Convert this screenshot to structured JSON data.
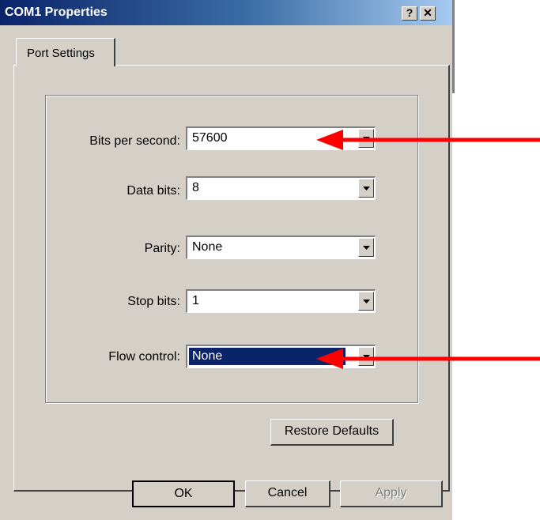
{
  "window": {
    "title": "COM1 Properties",
    "help_glyph": "?",
    "close_glyph": "✕"
  },
  "tabs": [
    {
      "label": "Port Settings"
    }
  ],
  "fields": {
    "bits_per_second": {
      "label": "Bits per second:",
      "value": "57600"
    },
    "data_bits": {
      "label": "Data bits:",
      "value": "8"
    },
    "parity": {
      "label": "Parity:",
      "value": "None"
    },
    "stop_bits": {
      "label": "Stop bits:",
      "value": "1"
    },
    "flow_control": {
      "label": "Flow control:",
      "value": "None"
    }
  },
  "buttons": {
    "restore_defaults": "Restore Defaults",
    "ok": "OK",
    "cancel": "Cancel",
    "apply": "Apply"
  },
  "colors": {
    "title_bar": "#0a246a",
    "dialog_face": "#d4d0c8",
    "selection": "#0a246a",
    "annotation_arrow": "#ff0000"
  }
}
